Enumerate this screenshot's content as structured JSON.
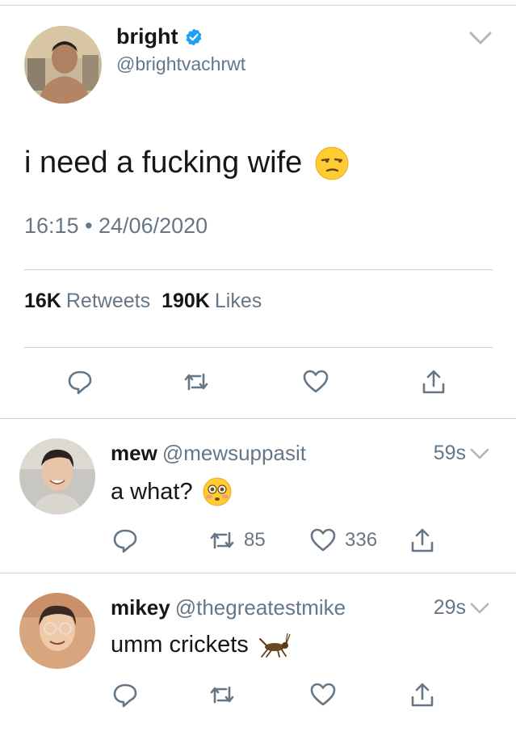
{
  "main_tweet": {
    "display_name": "bright",
    "handle": "@brightvachrwt",
    "text": "i need a fucking wife",
    "emoji": "unamused-face-icon",
    "timestamp": "16:15 • 24/06/2020",
    "retweets_count": "16K",
    "retweets_label": "Retweets",
    "likes_count": "190K",
    "likes_label": "Likes"
  },
  "replies": [
    {
      "display_name": "mew",
      "handle": "@mewsuppasit",
      "time": "59s",
      "text": "a what?",
      "emoji": "flushed-face-icon",
      "retweets": "85",
      "likes": "336"
    },
    {
      "display_name": "mikey",
      "handle": "@thegreatestmike",
      "time": "29s",
      "text": "umm crickets",
      "emoji": "cricket-icon",
      "retweets": "",
      "likes": ""
    }
  ],
  "colors": {
    "text": "#14171a",
    "secondary": "#657786",
    "verified": "#1da1f2",
    "divider": "#d0d4d8"
  }
}
